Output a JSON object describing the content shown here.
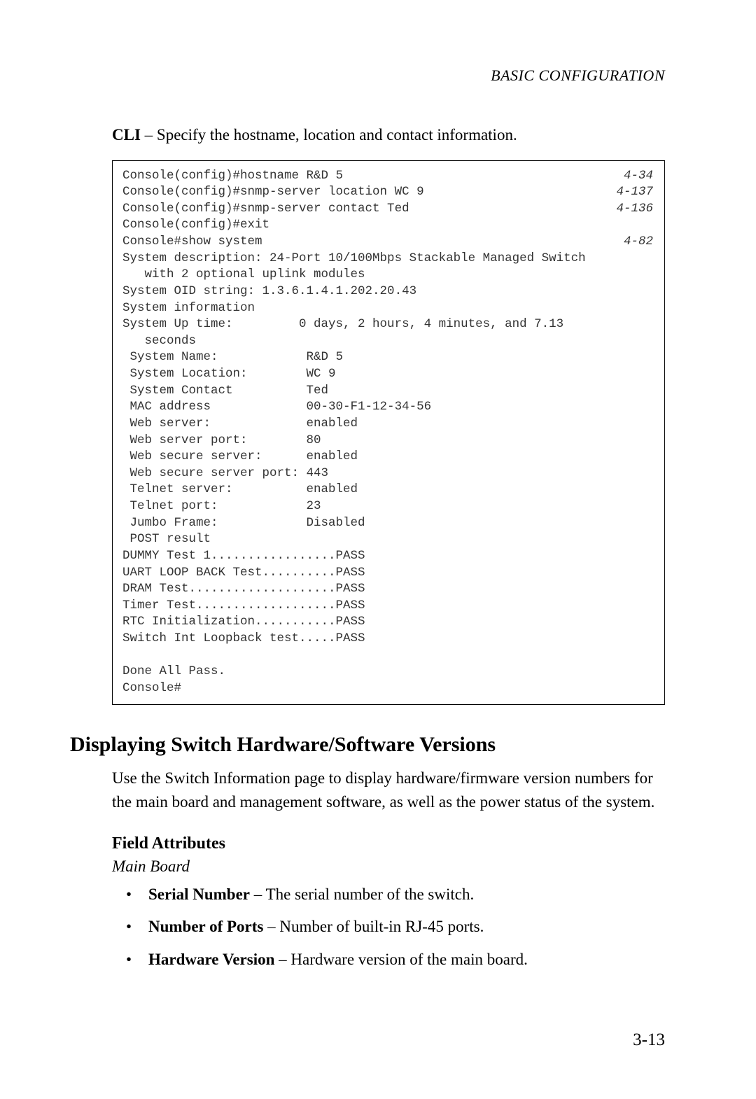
{
  "running_head": "BASIC CONFIGURATION",
  "cli_intro_bold": "CLI",
  "cli_intro_rest": " – Specify the hostname, location and contact information.",
  "cli": {
    "lines_with_ref": [
      {
        "text": "Console(config)#hostname R&D 5",
        "ref": "4-34"
      },
      {
        "text": "Console(config)#snmp-server location WC 9",
        "ref": "4-137"
      },
      {
        "text": "Console(config)#snmp-server contact Ted",
        "ref": "4-136"
      }
    ],
    "line_exit": "Console(config)#exit",
    "line_show": {
      "text": "Console#show system",
      "ref": "4-82"
    },
    "body": "System description: 24-Port 10/100Mbps Stackable Managed Switch\n   with 2 optional uplink modules\nSystem OID string: 1.3.6.1.4.1.202.20.43\nSystem information\nSystem Up time:         0 days, 2 hours, 4 minutes, and 7.13\n   seconds\n System Name:            R&D 5\n System Location:        WC 9\n System Contact          Ted\n MAC address             00-30-F1-12-34-56\n Web server:             enabled\n Web server port:        80\n Web secure server:      enabled\n Web secure server port: 443\n Telnet server:          enabled\n Telnet port:            23\n Jumbo Frame:            Disabled\n POST result\nDUMMY Test 1.................PASS\nUART LOOP BACK Test..........PASS\nDRAM Test....................PASS\nTimer Test...................PASS\nRTC Initialization...........PASS\nSwitch Int Loopback test.....PASS\n\nDone All Pass.\nConsole#"
  },
  "section_heading": "Displaying Switch Hardware/Software Versions",
  "body_para": "Use the Switch Information page to display hardware/firmware version numbers for the main board and management software, as well as the power status of the system.",
  "subsection_heading": "Field Attributes",
  "subhead_italic": "Main Board",
  "attributes": [
    {
      "term": "Serial Number",
      "desc": " – The serial number of the switch."
    },
    {
      "term": "Number of Ports",
      "desc": " – Number of built-in RJ-45 ports."
    },
    {
      "term": "Hardware Version",
      "desc": " – Hardware version of the main board."
    }
  ],
  "page_number": "3-13"
}
